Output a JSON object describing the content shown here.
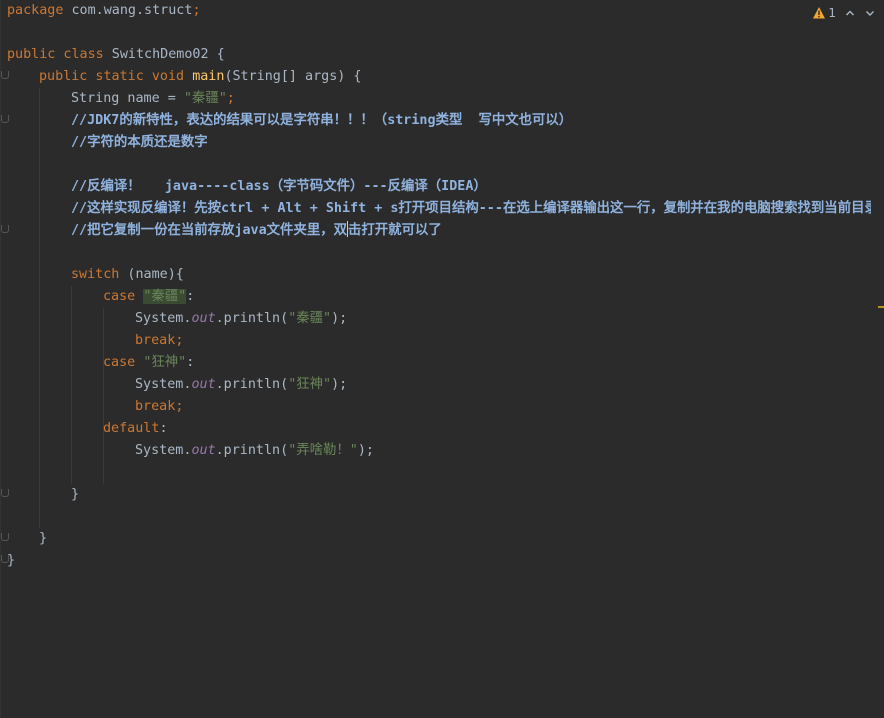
{
  "inspector": {
    "warning_count": "1"
  },
  "code": {
    "line1": {
      "kw": "package",
      "rest": " com.wang.struct",
      "semi": ";"
    },
    "line3": {
      "kw": "public class",
      "rest": " SwitchDemo02 {"
    },
    "line4": {
      "kw": "public static void",
      "fn": "main",
      "rest": "(String[] args) {"
    },
    "line5": {
      "pre": "String name = ",
      "str": "\"秦疆\"",
      "semi": ";"
    },
    "line6": {
      "c1": "//",
      "c2": "JDK7",
      "c3": "的新特性，表达的结果可以是字符串！！！（",
      "c4": "string",
      "c5": "类型  写中文也可以）"
    },
    "line7": {
      "c1": "//字符的本质还是数字"
    },
    "line9": {
      "c1": "//反编译！   ",
      "c2": "java----class",
      "c3": "（字节码文件）",
      "c4": "---",
      "c5": "反编译（",
      "c6": "IDEA",
      "c7": "）"
    },
    "line10": {
      "c1": "//这样实现反编译！先按",
      "c2": "ctrl + Alt + Shift + s",
      "c3": "打开项目结构",
      "c4": "---",
      "c5": "在选上编译器输出这一行，复制并在我的电脑搜索找到当前目录"
    },
    "line11": {
      "c1": "//把它复制一份在当前存放",
      "c2": "java",
      "c3": "文件夹里，双",
      "c4": "击打开就可以了"
    },
    "line13": {
      "kw": "switch",
      "rest": " (name){"
    },
    "line14": {
      "kw": "case",
      "str": "\"秦疆\"",
      "rest": ":"
    },
    "line15": {
      "pre": "System.",
      "field": "out",
      "mid": ".println(",
      "str": "\"秦疆\"",
      "post": ");"
    },
    "line16": {
      "kw": "break",
      "semi": ";"
    },
    "line17": {
      "kw": "case",
      "str": "\"狂神\"",
      "rest": ":"
    },
    "line18": {
      "pre": "System.",
      "field": "out",
      "mid": ".println(",
      "str": "\"狂神\"",
      "post": ");"
    },
    "line19": {
      "kw": "break",
      "semi": ";"
    },
    "line20": {
      "kw": "default",
      "rest": ":"
    },
    "line21": {
      "pre": "System.",
      "field": "out",
      "mid": ".println(",
      "str": "\"弄啥勒！\"",
      "post": ");"
    },
    "line23": {
      "rest": "}"
    },
    "line25": {
      "rest": "}"
    },
    "line26": {
      "rest": "}"
    }
  },
  "colors": {
    "background": "#2b2b2b",
    "keyword": "#cc7832",
    "string": "#6a8759",
    "method": "#ffc66d",
    "field": "#9876aa",
    "comment": "#629755",
    "warning": "#f0a732"
  },
  "icons": [
    "warning-icon",
    "chevron-up-icon",
    "chevron-down-icon"
  ]
}
